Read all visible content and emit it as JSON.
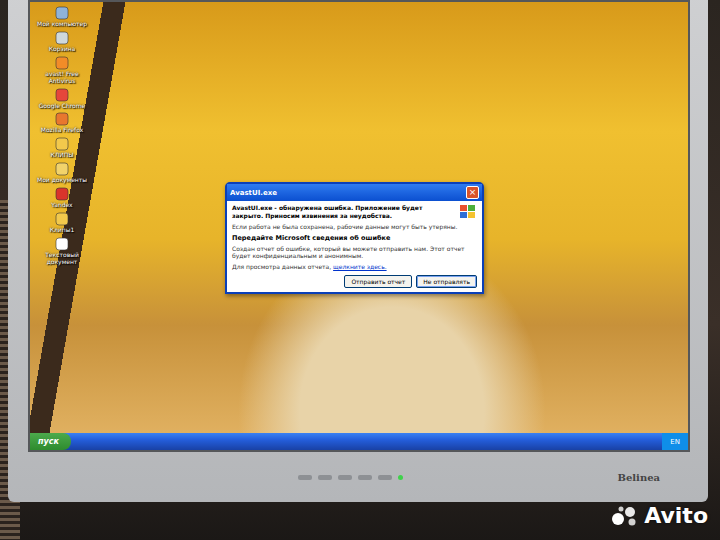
{
  "desktop_icons": [
    {
      "label": "Мой компьютер"
    },
    {
      "label": "Корзина"
    },
    {
      "label": "avast! Free Antivirus"
    },
    {
      "label": "Google Chrome"
    },
    {
      "label": "Mozilla Firefox"
    },
    {
      "label": "КЛИПЫ"
    },
    {
      "label": "Мои документы"
    },
    {
      "label": "Yandex"
    },
    {
      "label": "Клипы1"
    },
    {
      "label": "Текстовый документ"
    }
  ],
  "dialog": {
    "title": "AvastUI.exe",
    "message": "AvastUI.exe - обнаружена ошибка. Приложение будет закрыто. Приносим извинения за неудобства.",
    "note": "Если работа не была сохранена, рабочие данные могут быть утеряны.",
    "heading": "Передайте Microsoft сведения об ошибке",
    "body": "Создан отчет об ошибке, который вы можете отправить нам. Этот отчет будет конфиденциальным и анонимным.",
    "details_text": "Для просмотра данных отчета,",
    "details_link": "щелкните здесь.",
    "close": "×",
    "buttons": [
      {
        "label": "Отправить отчет",
        "selected": false
      },
      {
        "label": "Не отправлять",
        "selected": true
      }
    ]
  },
  "taskbar": {
    "start": "пуск",
    "tray": "EN"
  },
  "monitor": {
    "brand": "Belinea",
    "power_on": true
  },
  "watermark": "Avito"
}
